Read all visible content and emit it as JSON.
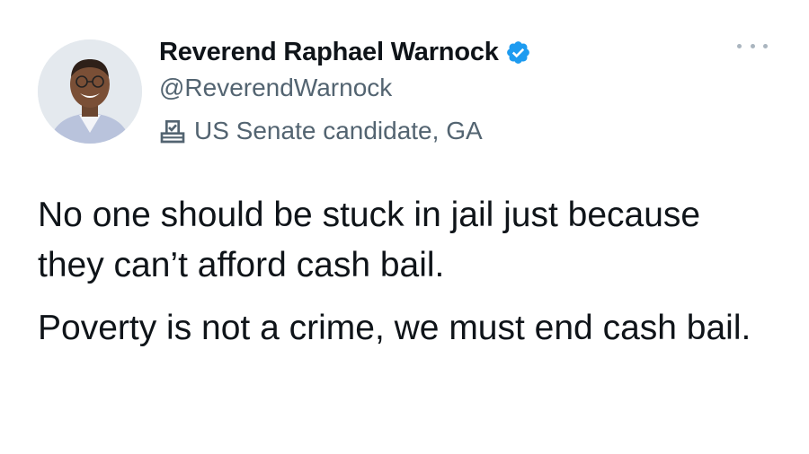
{
  "author": {
    "display_name": "Reverend Raphael Warnock",
    "handle": "@ReverendWarnock",
    "verified": true,
    "affiliation_label": "US Senate candidate, GA",
    "avatar_icon": "profile-photo",
    "verified_icon": "verified-badge-icon",
    "affiliation_icon": "ballot-box-icon"
  },
  "tweet": {
    "paragraphs": [
      "No one should be stuck in jail just because they can’t afford cash bail.",
      "Poverty is not a crime, we must end cash bail."
    ]
  },
  "menu": {
    "icon": "more-options-icon"
  },
  "colors": {
    "text_primary": "#0f1419",
    "text_secondary": "#536471",
    "verified_blue": "#1d9bf0",
    "background": "#ffffff"
  }
}
